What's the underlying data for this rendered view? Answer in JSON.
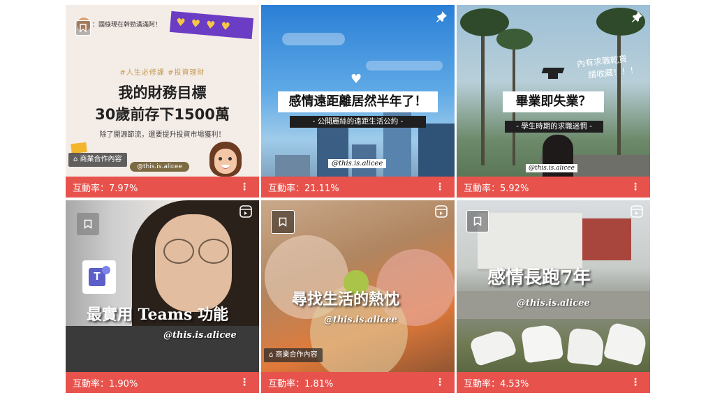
{
  "posts": [
    {
      "top_note": "：國綠現在幹勁滿滿阿！",
      "tags": "#人生必修課 #投資理財",
      "title_line1": "我的財務目標",
      "title_line2": "30歲前存下1500萬",
      "subtitle": "除了開源節流，還要提升投資市場獲利！",
      "sponsor_label": "商業合作內容",
      "handle": "@this.is.alicee",
      "engagement": "互動率：7.97%"
    },
    {
      "headline": "感情遠距離居然半年了！",
      "subline": "- 公開麗絲的遠距生活公約 -",
      "handle": "@this.is.alicee",
      "engagement": "互動率：21.11%"
    },
    {
      "side_note_line1": "內有求職乾貨",
      "side_note_line2": "請收藏！！！",
      "headline": "畢業即失業？",
      "subline": "- 學生時期的求職迷惘 -",
      "handle": "@this.is.alicee",
      "engagement": "互動率：5.92%"
    },
    {
      "title": "最實用 Teams 功能",
      "handle": "@this.is.alicee",
      "engagement": "互動率：1.90%"
    },
    {
      "title": "尋找生活的熱忱",
      "handle": "@this.is.alicee",
      "sponsor_label": "商業合作內容",
      "engagement": "互動率：1.81%"
    },
    {
      "title": "感情長跑7年",
      "handle": "@this.is.alicee",
      "engagement": "互動率：4.53%"
    }
  ],
  "icons": {
    "pin": "pin-icon",
    "reel": "reel-icon",
    "bookmark": "bookmark-icon",
    "more": "more-options-icon",
    "bag": "shopping-bag-icon"
  },
  "colors": {
    "engagement_bar": "#e8524c"
  }
}
